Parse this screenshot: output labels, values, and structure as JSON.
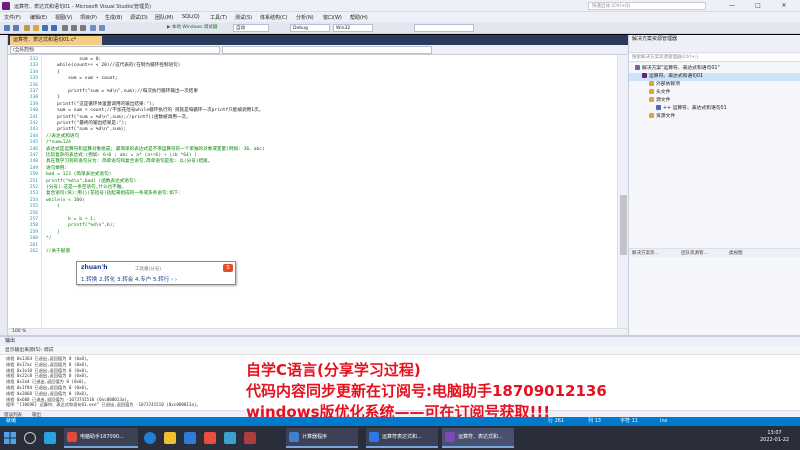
{
  "window": {
    "title": "运算符、表达式和语句01 - Microsoft Visual Studio(管理员)",
    "quick_launch_placeholder": "快速启动 (Ctrl+Q)",
    "minimize": "—",
    "maximize": "□",
    "close": "✕"
  },
  "menu": [
    "文件(F)",
    "编辑(E)",
    "视图(V)",
    "项目(P)",
    "生成(B)",
    "调试(D)",
    "团队(M)",
    "SQL(Q)",
    "工具(T)",
    "测试(S)",
    "体系结构(C)",
    "分析(N)",
    "窗口(W)",
    "帮助(H)"
  ],
  "toolbar": {
    "debugger_target": "▶ 本地 Windows 调试器",
    "auto": "自动",
    "config": "Debug",
    "platform": "Win32"
  },
  "editor": {
    "tab_title": "运算符、表达式和语句01.c*",
    "scope": "(全局范围)",
    "lines": [
      {
        "n": "232",
        "t": "            sum = 0;"
      },
      {
        "n": "233",
        "t": "    while(count++ < 20)//这代表的(在制为循环控制语句)"
      },
      {
        "n": "234",
        "t": "    {"
      },
      {
        "n": "235",
        "t": "        sum = sum + count;"
      },
      {
        "n": "236",
        "t": ""
      },
      {
        "n": "237",
        "t": "        printf(\"sum = %d\\n\",sum);//每次执行循环输出一次结果"
      },
      {
        "n": "238",
        "t": "    }"
      },
      {
        "n": "239",
        "t": "    printf(\"这是循环体里面调用的输出结果:\");"
      },
      {
        "n": "240",
        "t": "    sum = sum + count;//不加花括号while循环执行的 则就是每循环一次printf只能被调用1次。"
      },
      {
        "n": "241",
        "t": "    printf(\"sum = %d\\n\",sum);//printf()函数被调用一次。"
      },
      {
        "n": "242",
        "t": "    printf(\"最终的输出结果是:\");"
      },
      {
        "n": "243",
        "t": "    printf(\"sum = %d\\n\",sum);"
      },
      {
        "n": "244",
        "t": "//表达式和语句"
      },
      {
        "n": "245",
        "t": "/*sum=124"
      },
      {
        "n": "246",
        "t": "表达式是运算符和运算对象组成; 最简单的表达式是不带运算符的一个单独的对象或变量(例如: 36、abc)"
      },
      {
        "n": "247",
        "t": "比较复杂的表达式:(例如: 6+6 ; abc = a* (a++6) + (cb *64) )"
      },
      {
        "n": "248",
        "t": "具在我学习到的语句分为: 简单语句和复合语句,简单语句是指: 以(分号)结尾。"
      },
      {
        "n": "249",
        "t": "语句举例:"
      },
      {
        "n": "250",
        "t": "bad = 123 (简单表达式语句)"
      },
      {
        "n": "251",
        "t": "printf(\"%d\\n\",bad) (函数表达式语句)"
      },
      {
        "n": "252",
        "t": "(分号):这是一条空语句,什么也不做。"
      },
      {
        "n": "253",
        "t": "复合语句(块):用{}(花括号)括起来组成的一条或多条语句:如下:"
      },
      {
        "n": "254",
        "t": "while(x < 100)"
      },
      {
        "n": "255",
        "t": "    {"
      },
      {
        "n": "256",
        "t": ""
      },
      {
        "n": "257",
        "t": "        b = b + 1;"
      },
      {
        "n": "258",
        "t": "        printf(\"%d\\n\",b);"
      },
      {
        "n": "259",
        "t": "    }"
      },
      {
        "n": "260",
        "t": "*/"
      },
      {
        "n": "261",
        "t": ""
      },
      {
        "n": "262",
        "t": "//关于赋值"
      }
    ],
    "zoom": "100 %"
  },
  "ime": {
    "pinyin": "zhuan'h",
    "hint": "工具箱(分号)",
    "logo": "S",
    "candidates": "1.转换  2.转化  3.转会  4.专户  5.转行  ‹ ›"
  },
  "solution": {
    "header": "解决方案资源管理器",
    "search_placeholder": "搜索解决方案资源管理器(Ctrl+;)",
    "tree": [
      {
        "label": "解决方案\"运算符、表达式和语句01\"",
        "depth": 0,
        "color": "#7b5ea7"
      },
      {
        "label": "运算符、表达式和语句01",
        "depth": 1,
        "color": "#68217a"
      },
      {
        "label": "外部依赖项",
        "depth": 2,
        "color": "#d7a83a"
      },
      {
        "label": "头文件",
        "depth": 2,
        "color": "#d7a83a"
      },
      {
        "label": "源文件",
        "depth": 2,
        "color": "#d7a83a"
      },
      {
        "label": "++ 运算符、表达式和语句01",
        "depth": 3,
        "color": "#4a6bb5"
      },
      {
        "label": "资源文件",
        "depth": 2,
        "color": "#d7a83a"
      }
    ],
    "bottom_tabs": [
      "解决方案资...",
      "团队资源管...",
      "类视图"
    ]
  },
  "output": {
    "header": "输出",
    "source_label": "显示输出来源(S): 调试",
    "lines": [
      "线程 0x1364 已退出,返回值为 0 (0x0)。",
      "线程 0x17ac 已退出,返回值为 0 (0x0)。",
      "线程 0x1e10 已退出,返回值为 0 (0x0)。",
      "线程 0x22c8 已退出,返回值为 0 (0x0)。",
      "线程 0x2a4 已退出,返回值为 0 (0x0)。",
      "线程 0x1f84 已退出,返回值为 0 (0x0)。",
      "线程 0x2068 已退出,返回值为 0 (0x0)。",
      "线程 0x600 已退出,返回值为 -1073741510 (0xc000013a)。",
      "程序 \"[10696] 运算符、表达式和语句01.exe\" 已退出,返回值为 -1073741510 (0xc000013a)。"
    ],
    "tabs": [
      "错误列表",
      "输出"
    ]
  },
  "overlay": {
    "line1": "自学C语言(分享学习过程)",
    "line2": "代码内容同步更新在订阅号:电脑助手18709012136",
    "line3": "windows版优化系统——可在订阅号获取!!!"
  },
  "status": {
    "left": "就绪",
    "row": "行 261",
    "col": "列 13",
    "ch": "字符 11",
    "ins": "Ins"
  },
  "taskbar": {
    "apps": [
      "电脑助手187090...",
      "计算器程序",
      "运算符表达式和...",
      "运算符、表达式和..."
    ],
    "time": "13:07",
    "date": "2022-01-22"
  }
}
